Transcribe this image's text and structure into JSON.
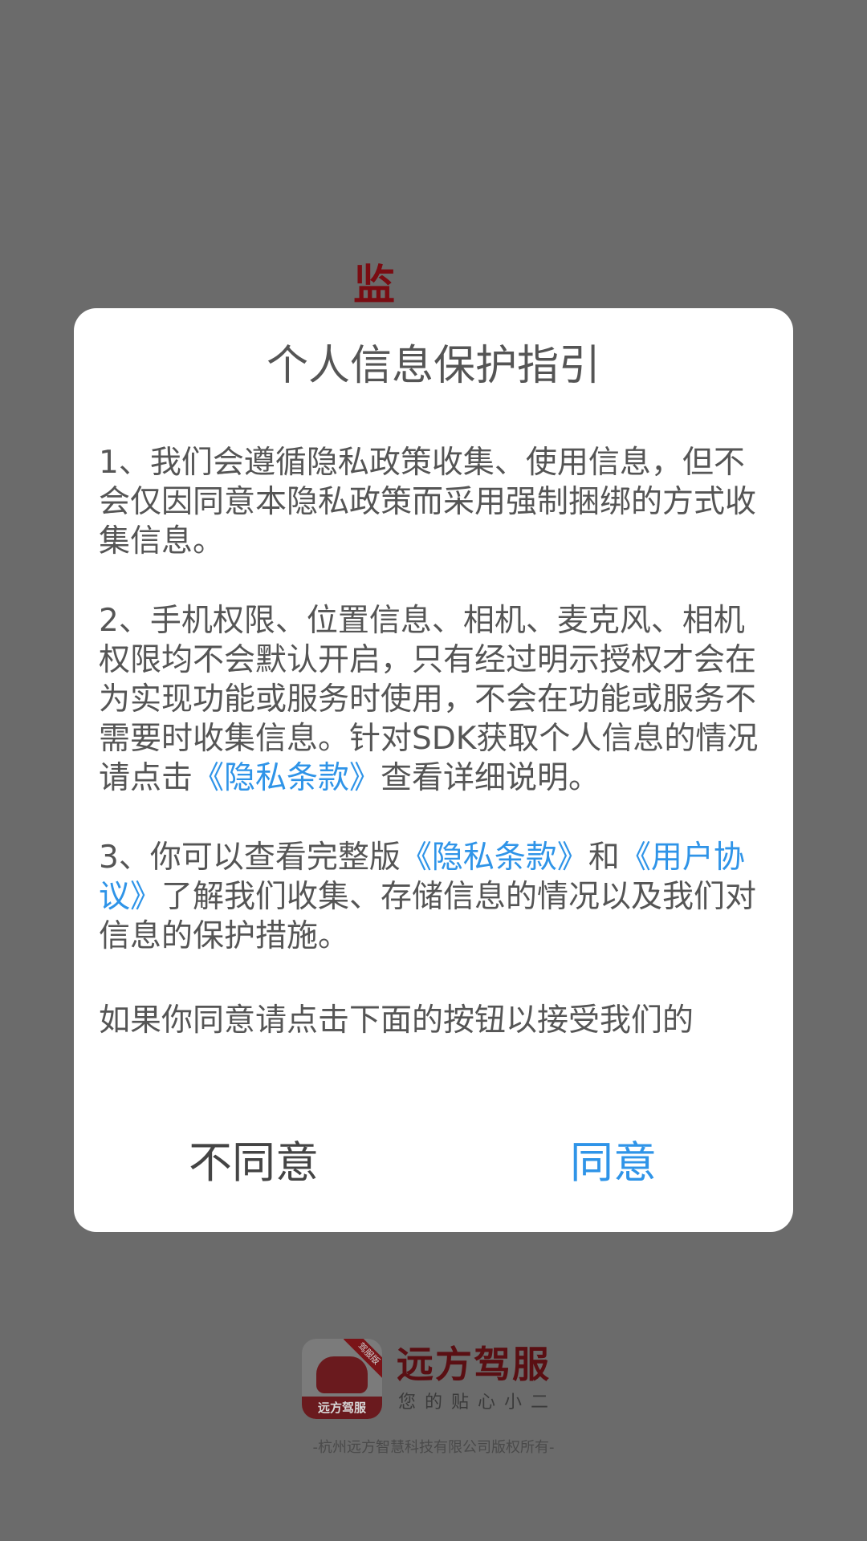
{
  "background": {
    "splash_char": "监"
  },
  "dialog": {
    "title": "个人信息保护指引",
    "paragraphs": {
      "p1": "1、我们会遵循隐私政策收集、使用信息，但不会仅因同意本隐私政策而采用强制捆绑的方式收集信息。",
      "p2_before": "2、手机权限、位置信息、相机、麦克风、相机权限均不会默认开启，只有经过明示授权才会在为实现功能或服务时使用，不会在功能或服务不需要时收集信息。针对SDK获取个人信息的情况请点击",
      "p2_link": "《隐私条款》",
      "p2_after": "查看详细说明。",
      "p3_before": "3、你可以查看完整版",
      "p3_link1": "《隐私条款》",
      "p3_mid": "和",
      "p3_link2": "《用户协议》",
      "p3_after": "了解我们收集、存储信息的情况以及我们对信息的保护措施。",
      "p4": "如果你同意请点击下面的按钮以接受我们的"
    },
    "buttons": {
      "disagree": "不同意",
      "agree": "同意"
    }
  },
  "brand": {
    "icon_label": "远方驾服",
    "ribbon": "驾服版",
    "name": "远方驾服",
    "slogan": "您的贴心小二"
  },
  "footer": {
    "copyright": "-杭州远方智慧科技有限公司版权所有-"
  },
  "colors": {
    "overlay": "#6b6b6b",
    "link": "#2f94e8",
    "text": "#555555",
    "brand": "#7a0c12"
  }
}
